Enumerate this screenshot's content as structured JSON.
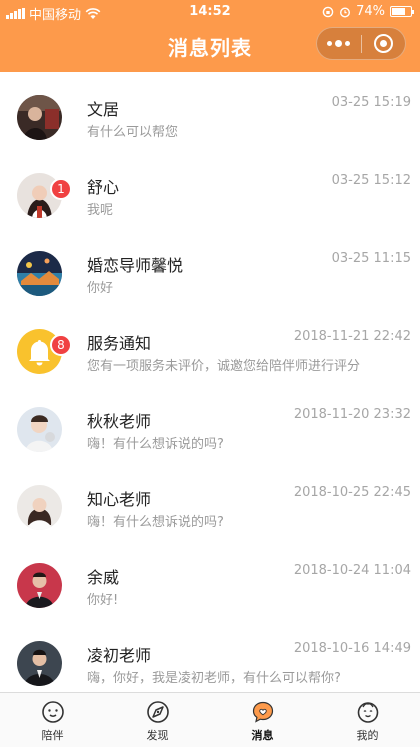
{
  "statusbar": {
    "carrier": "中国移动",
    "time": "14:52",
    "battery": "74%",
    "battery_level": 0.74
  },
  "header": {
    "title": "消息列表"
  },
  "messages": [
    {
      "name": "文居",
      "preview": "有什么可以帮您",
      "time": "03-25 15:19",
      "badge": ""
    },
    {
      "name": "舒心",
      "preview": "我呢",
      "time": "03-25 15:12",
      "badge": "1"
    },
    {
      "name": "婚恋导师馨悦",
      "preview": "你好",
      "time": "03-25 11:15",
      "badge": ""
    },
    {
      "name": "服务通知",
      "preview": "您有一项服务未评价，诚邀您给陪伴师进行评分",
      "time": "2018-11-21 22:42",
      "badge": "8"
    },
    {
      "name": "秋秋老师",
      "preview": "嗨！有什么想诉说的吗?",
      "time": "2018-11-20 23:32",
      "badge": ""
    },
    {
      "name": "知心老师",
      "preview": "嗨！有什么想诉说的吗?",
      "time": "2018-10-25 22:45",
      "badge": ""
    },
    {
      "name": "余威",
      "preview": "你好!",
      "time": "2018-10-24 11:04",
      "badge": ""
    },
    {
      "name": "凌初老师",
      "preview": "嗨，你好，我是凌初老师，有什么可以帮你?",
      "time": "2018-10-16 14:49",
      "badge": ""
    }
  ],
  "tabs": [
    {
      "label": "陪伴",
      "icon": "smile-face-icon"
    },
    {
      "label": "发现",
      "icon": "compass-icon"
    },
    {
      "label": "消息",
      "icon": "chat-bubble-icon",
      "active": true
    },
    {
      "label": "我的",
      "icon": "profile-face-icon"
    }
  ],
  "colors": {
    "header": "#fd9a4b",
    "badge": "#f04142",
    "notify": "#f9c22d"
  }
}
